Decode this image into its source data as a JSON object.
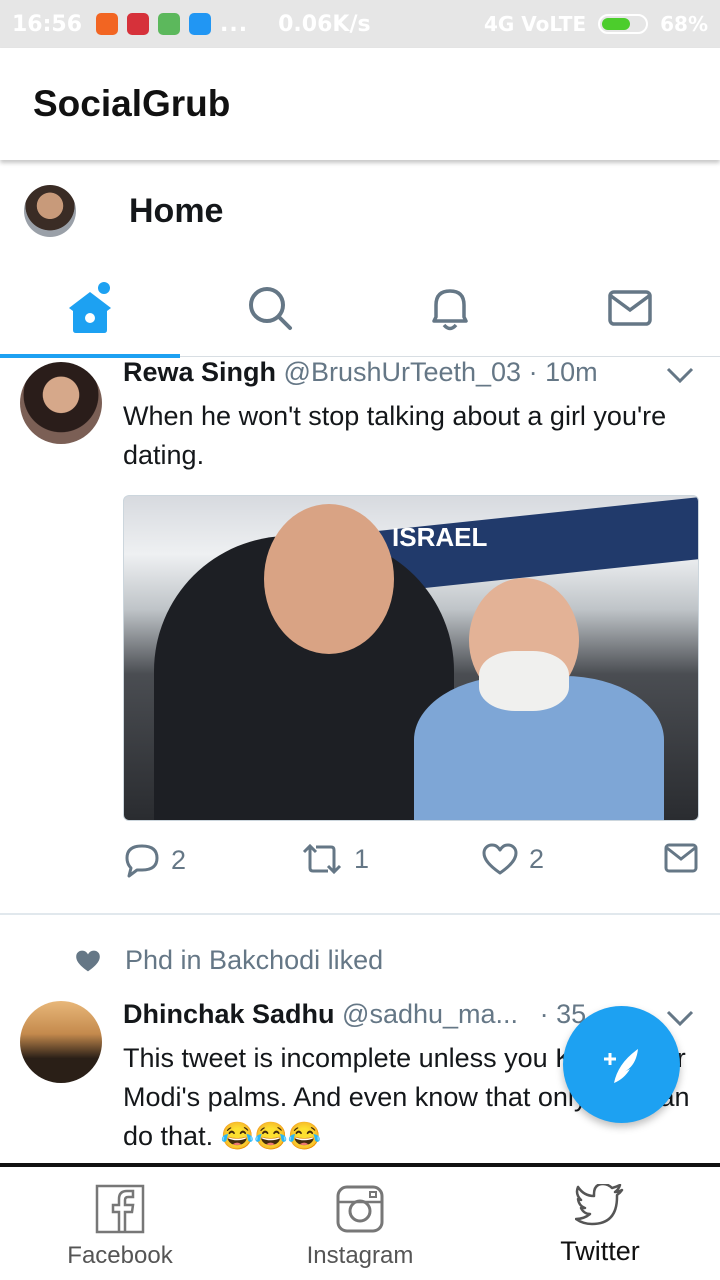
{
  "status_bar": {
    "time": "16:56",
    "dots": "...",
    "network": "0.06K/s",
    "signal": "4G VoLTE",
    "battery": "68%",
    "battery_level": 0.68
  },
  "app": {
    "title": "SocialGrub"
  },
  "twitter": {
    "header_title": "Home",
    "tabs": [
      {
        "icon": "home-icon",
        "active": true
      },
      {
        "icon": "search-icon",
        "active": false
      },
      {
        "icon": "bell-icon",
        "active": false
      },
      {
        "icon": "mail-icon",
        "active": false
      }
    ]
  },
  "tweets": [
    {
      "name": "Rewa Singh",
      "handle": "@BrushUrTeeth_03",
      "sep": "·",
      "time": "10m",
      "text": "When he won't stop talking about a girl you're dating.",
      "banner": "ISRAEL",
      "replies": "2",
      "retweets": "1",
      "likes": "2"
    },
    {
      "liked_by": "Phd in Bakchodi liked",
      "name": "Dhinchak Sadhu",
      "handle": "@sadhu_ma...",
      "sep": "·",
      "time": "35",
      "text": "This tweet is incomplete unless you Kejri under Modi's palms. And even know that only you can do that. 😂😂😂"
    }
  ],
  "bottom_nav": [
    {
      "label": "Facebook",
      "icon": "facebook-icon"
    },
    {
      "label": "Instagram",
      "icon": "instagram-icon"
    },
    {
      "label": "Twitter",
      "icon": "twitter-icon",
      "active": true
    }
  ],
  "colors": {
    "accent": "#1da1f2",
    "muted": "#657786"
  }
}
